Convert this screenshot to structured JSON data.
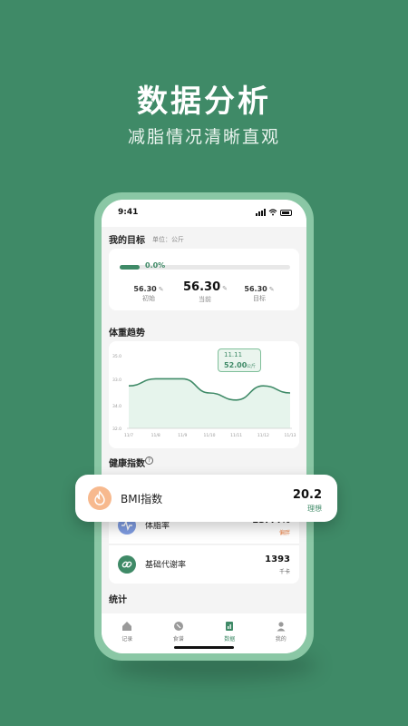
{
  "promo": {
    "title": "数据分析",
    "subtitle": "减脂情况清晰直观"
  },
  "status": {
    "time": "9:41"
  },
  "goal": {
    "title": "我的目标",
    "unit_label": "单位：公斤",
    "progress_text": "0.0%",
    "progress": 0.0,
    "start": {
      "value": "56.30",
      "label": "初始"
    },
    "current": {
      "value": "56.30",
      "label": "当前"
    },
    "target": {
      "value": "56.30",
      "label": "目标"
    }
  },
  "trend": {
    "title": "体重趋势"
  },
  "chart_data": {
    "type": "area",
    "x": [
      "11/7",
      "11/8",
      "11/9",
      "11/10",
      "11/11",
      "11/12",
      "11/13"
    ],
    "series": [
      {
        "values": [
          52.2,
          52.3,
          52.3,
          52.1,
          52.0,
          52.2,
          52.1
        ]
      }
    ],
    "y_ticks": [
      "35.0",
      "33.0",
      "34.0",
      "32.0"
    ],
    "tooltip": {
      "date": "11.11",
      "value": "52.00",
      "unit": "公斤"
    },
    "grid": false
  },
  "health": {
    "title": "健康指数",
    "bmi": {
      "name": "BMI指数",
      "value": "20.2",
      "status": "理想"
    },
    "bodyfat": {
      "name": "体脂率",
      "value": "23.44%",
      "status": "偏胖"
    },
    "bmr": {
      "name": "基础代谢率",
      "value": "1393",
      "unit": "千卡"
    }
  },
  "stats": {
    "title": "统计"
  },
  "tabs": [
    {
      "label": "记录"
    },
    {
      "label": "食谱"
    },
    {
      "label": "数据"
    },
    {
      "label": "我的"
    }
  ],
  "colors": {
    "accent": "#3f8a67",
    "warning": "#e8834a",
    "background": "#3f8a67"
  }
}
